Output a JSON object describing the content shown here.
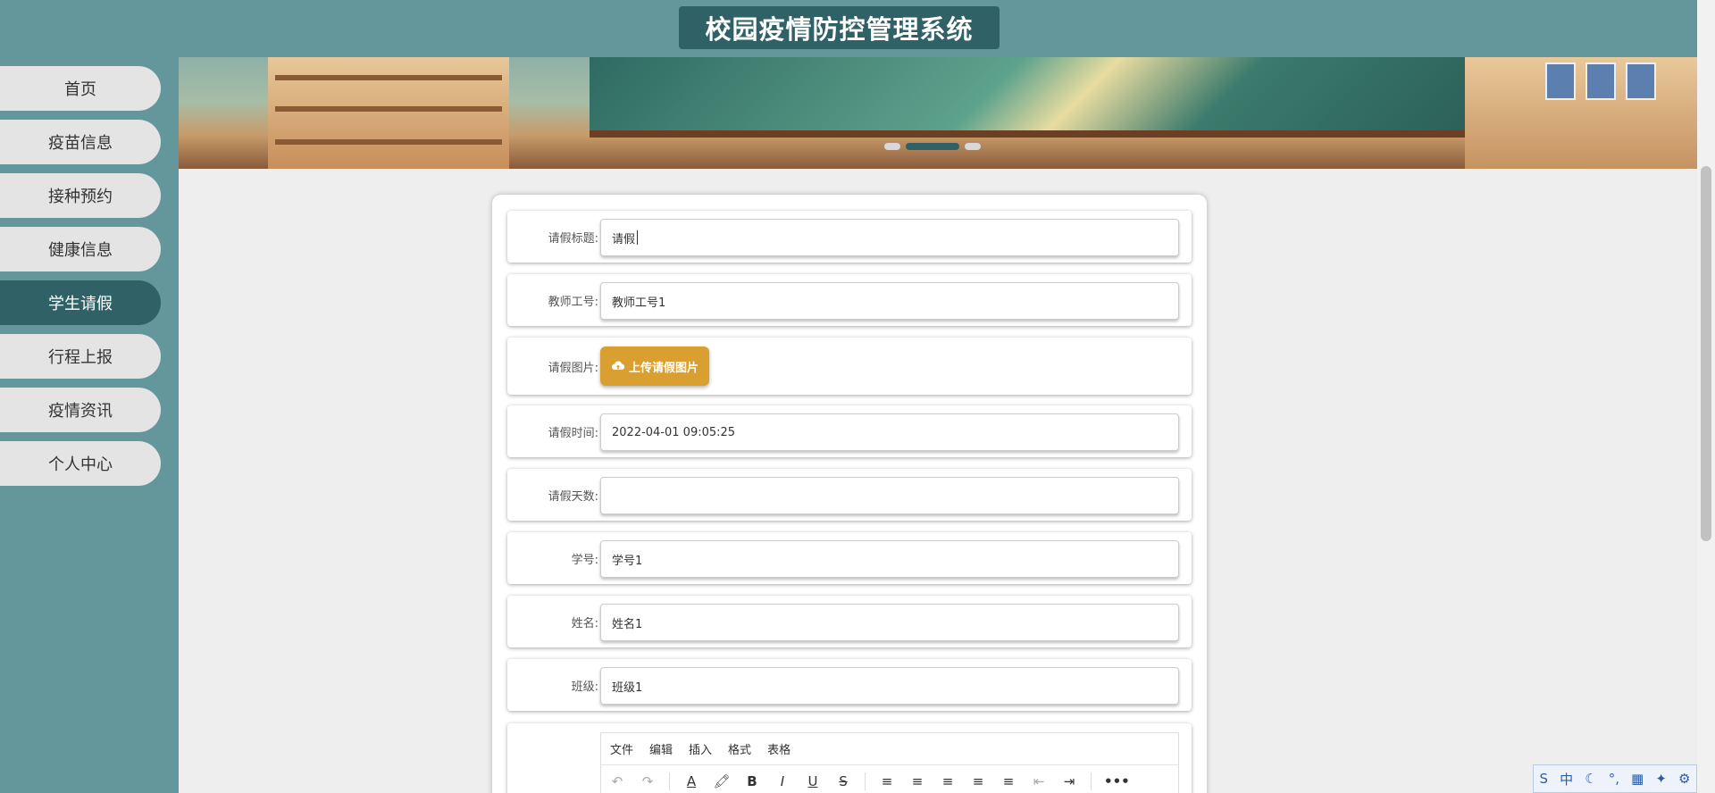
{
  "header": {
    "title": "校园疫情防控管理系统"
  },
  "sidebar": {
    "items": [
      {
        "label": "首页"
      },
      {
        "label": "疫苗信息"
      },
      {
        "label": "接种预约"
      },
      {
        "label": "健康信息"
      },
      {
        "label": "学生请假"
      },
      {
        "label": "行程上报"
      },
      {
        "label": "疫情资讯"
      },
      {
        "label": "个人中心"
      }
    ],
    "active": "学生请假"
  },
  "form": {
    "fields": [
      {
        "label": "请假标题:",
        "value": "请假"
      },
      {
        "label": "教师工号:",
        "value": "教师工号1"
      },
      {
        "label": "请假图片:",
        "button": "上传请假图片"
      },
      {
        "label": "请假时间:",
        "value": "2022-04-01 09:05:25"
      },
      {
        "label": "请假天数:",
        "value": ""
      },
      {
        "label": "学号:",
        "value": "学号1"
      },
      {
        "label": "姓名:",
        "value": "姓名1"
      },
      {
        "label": "班级:",
        "value": "班级1"
      }
    ]
  },
  "editor": {
    "menu": [
      "文件",
      "编辑",
      "插入",
      "格式",
      "表格"
    ],
    "tools": [
      "↶",
      "↷",
      "A",
      "🖍",
      "B",
      "I",
      "U",
      "S",
      "≡",
      "≡",
      "≡",
      "≡",
      "≡",
      "⇤",
      "⇥",
      "•••"
    ]
  },
  "ime": {
    "icons": [
      "S",
      "中",
      "☾",
      "°,",
      "▦",
      "✦",
      "⚙"
    ]
  },
  "colors": {
    "primary": "#2f6166",
    "sidebar_bg": "#64979b",
    "upload": "#d9a031"
  }
}
